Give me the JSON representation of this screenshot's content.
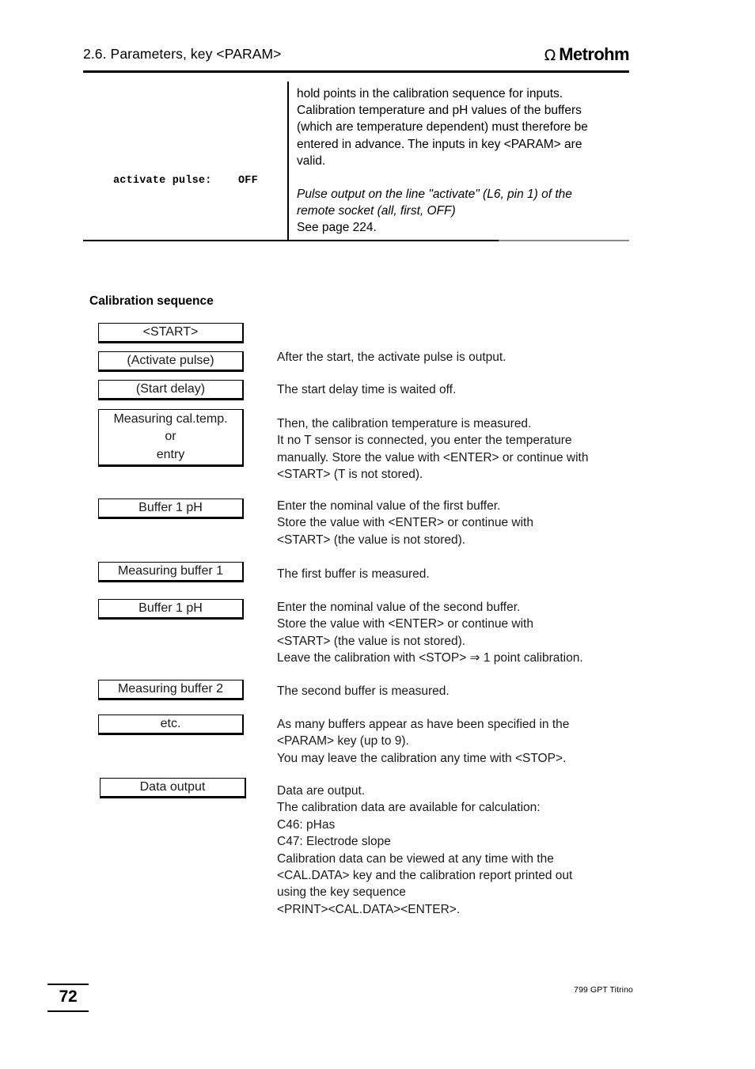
{
  "header": {
    "title": "2.6. Parameters, key <PARAM>",
    "brand": "Metrohm",
    "brand_icon": "omega-symbol",
    "omega_glyph": "Ω"
  },
  "param_table": {
    "label_name": "activate pulse:",
    "label_value": "OFF",
    "description_paragraphs": [
      {
        "style": "normal",
        "lines": [
          "hold points in the calibration sequence for inputs.",
          "Calibration temperature and pH values of the buffers",
          "(which are temperature dependent) must therefore be",
          "entered in advance. The inputs in key <PARAM> are",
          "valid."
        ]
      },
      {
        "style": "italic",
        "lines": [
          "Pulse output on the line \"activate\" (L6, pin 1) of the",
          "remote socket (all, first, OFF)"
        ]
      },
      {
        "style": "normal",
        "lines": [
          "See page 224."
        ]
      }
    ]
  },
  "section": {
    "heading": "Calibration sequence"
  },
  "flow": {
    "steps": [
      {
        "box_lines": [
          "<START>"
        ],
        "text_lines": []
      },
      {
        "box_lines": [
          "(Activate pulse)"
        ],
        "text_lines": [
          "After the start, the activate pulse is output."
        ]
      },
      {
        "box_lines": [
          "(Start delay)"
        ],
        "text_lines": [
          "The start delay time is waited off."
        ]
      },
      {
        "box_lines": [
          "Measuring cal.temp.",
          "or",
          "entry"
        ],
        "text_lines": [
          "Then, the calibration temperature is measured.",
          "It no T sensor is connected, you enter the temperature",
          "manually. Store the value with <ENTER> or continue with",
          "<START> (T is not stored)."
        ]
      },
      {
        "box_lines": [
          "Buffer 1 pH"
        ],
        "text_lines": [
          "Enter the nominal value of the first buffer.",
          "Store the value  with <ENTER> or continue with",
          "<START> (the value is not stored)."
        ]
      },
      {
        "box_lines": [
          "Measuring buffer 1"
        ],
        "text_lines": [
          "The first buffer is measured."
        ]
      },
      {
        "box_lines": [
          "Buffer 1 pH"
        ],
        "text_lines": [
          "Enter the nominal value of the second buffer.",
          "Store the value  with <ENTER> or continue with",
          "<START> (the value is not stored).",
          "Leave the calibration with <STOP> ⇒ 1 point calibration."
        ]
      },
      {
        "box_lines": [
          "Measuring buffer 2"
        ],
        "text_lines": [
          "The second buffer is measured."
        ]
      },
      {
        "box_lines": [
          "etc."
        ],
        "text_lines": [
          "As many buffers appear as have been specified in the",
          "<PARAM> key (up to 9).",
          "You may leave the calibration any time with <STOP>."
        ]
      },
      {
        "box_lines": [
          "Data output"
        ],
        "text_lines": [
          "Data are output.",
          "The calibration data are available for calculation:",
          "C46: pHas",
          "C47: Electrode slope",
          "Calibration data can be viewed at any time with the",
          "<CAL.DATA> key and the calibration report printed out",
          "using the key sequence",
          "<PRINT><CAL.DATA><ENTER>."
        ]
      }
    ]
  },
  "footer": {
    "page_number": "72",
    "product": "799 GPT Titrino"
  }
}
